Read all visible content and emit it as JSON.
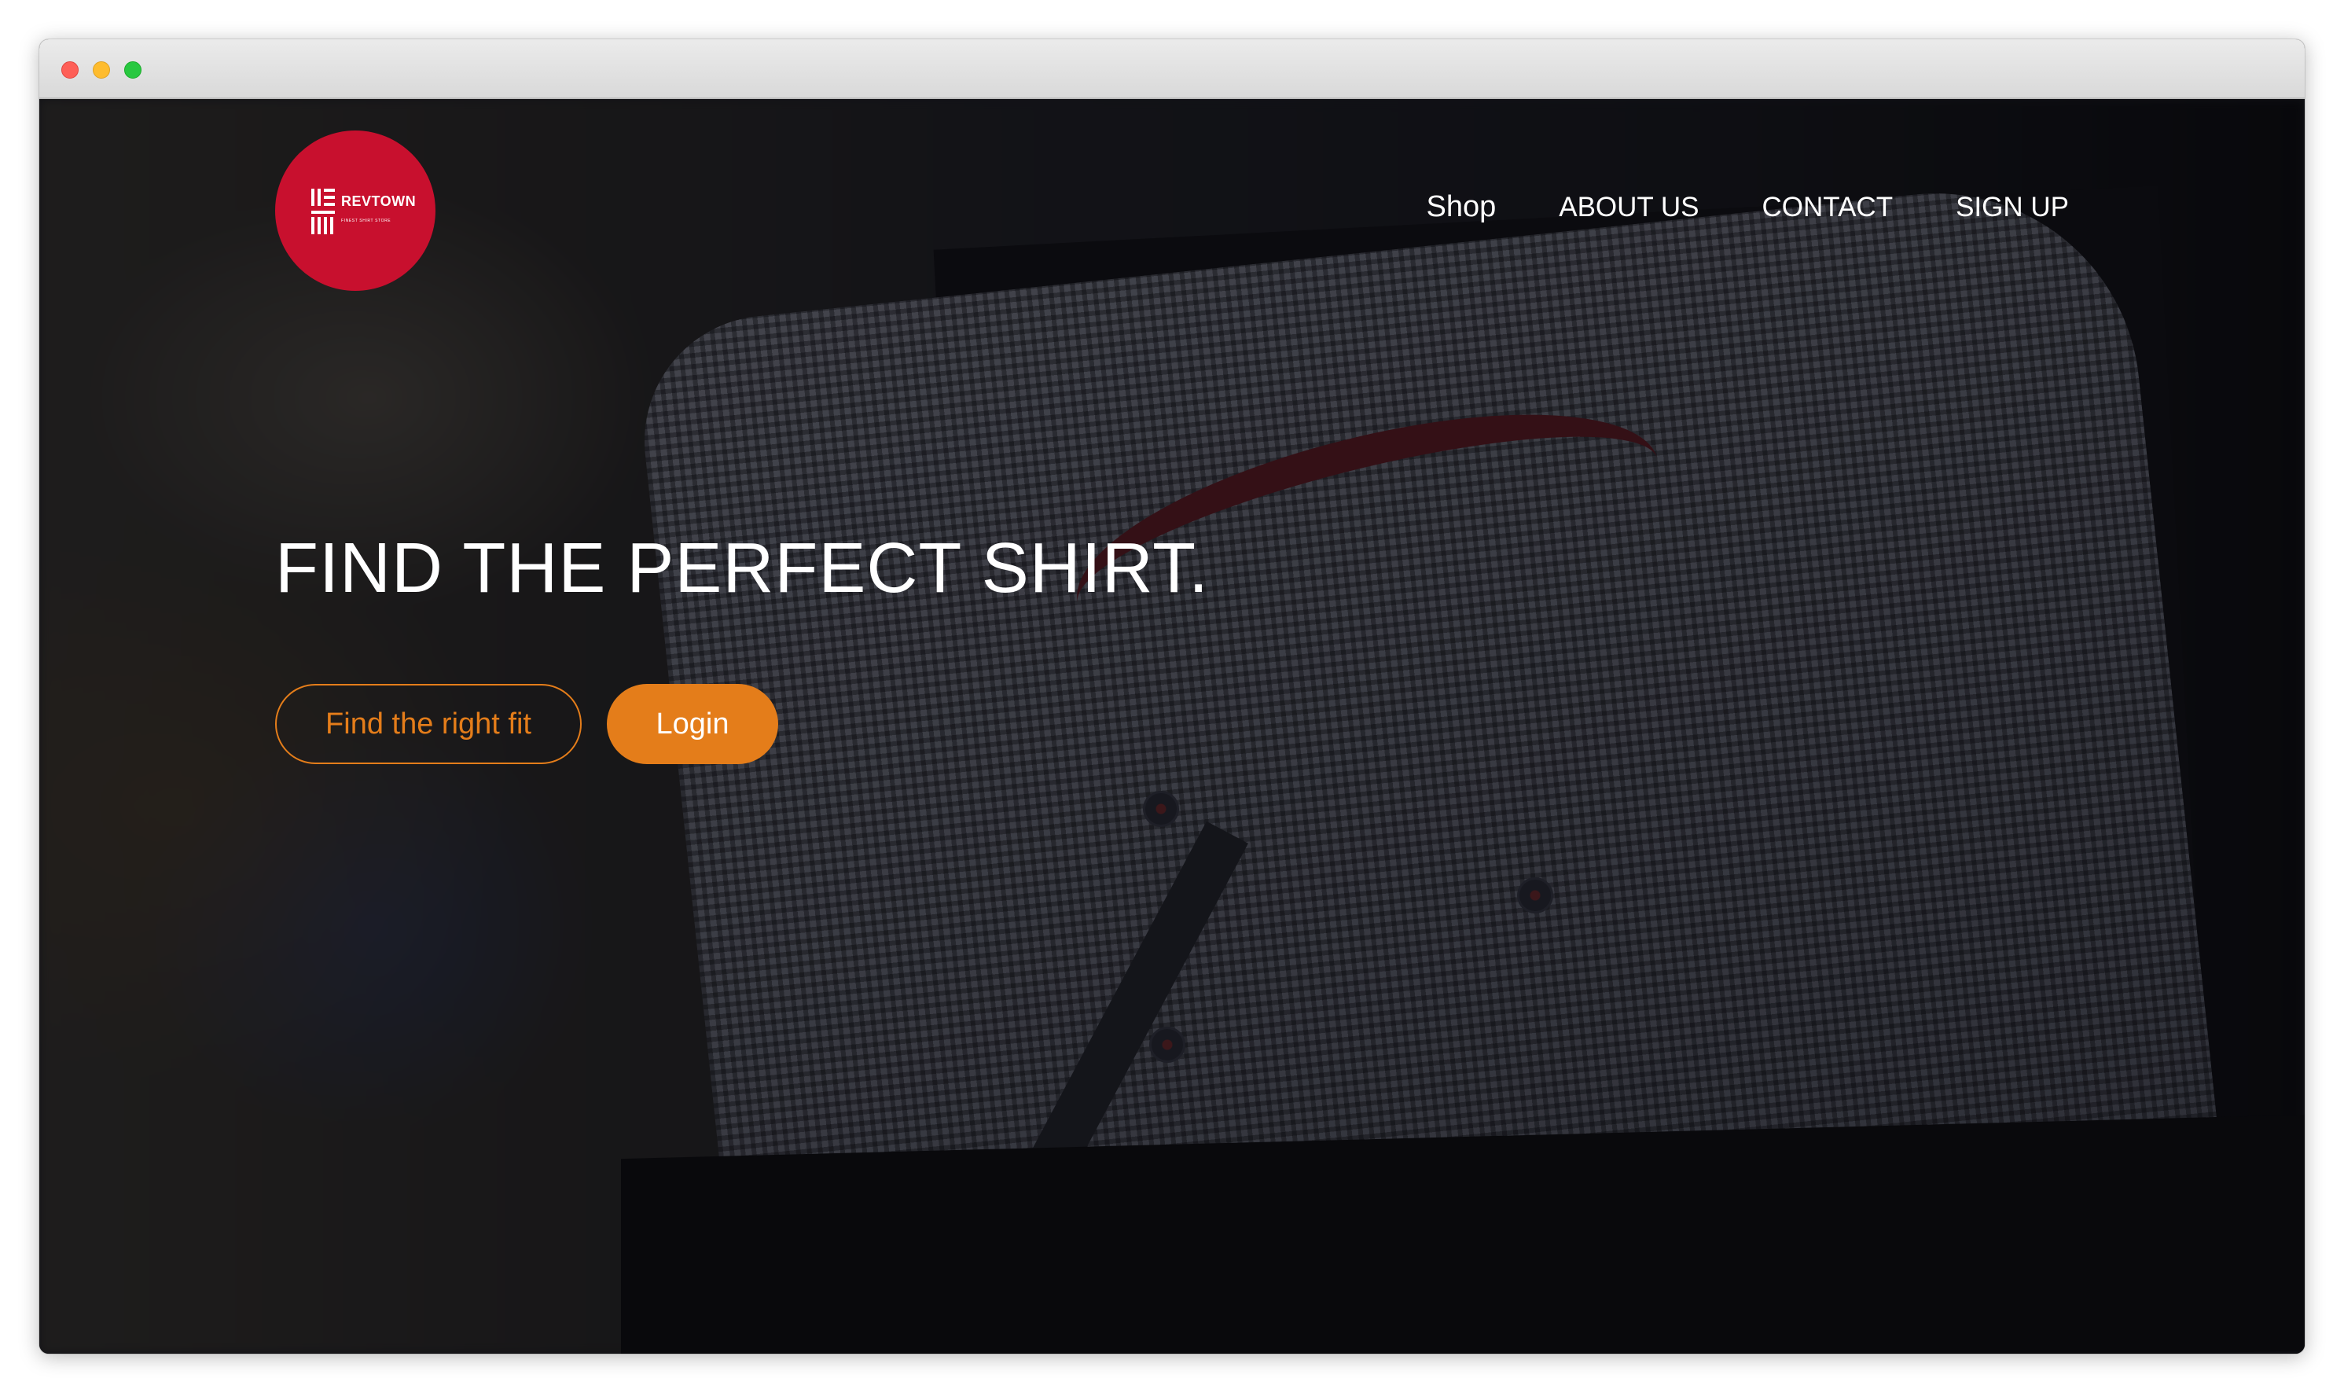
{
  "window": {
    "controls": [
      "close",
      "minimize",
      "zoom"
    ]
  },
  "brand": {
    "name": "REVTOWN",
    "tagline": "FINEST SHIRT STORE",
    "logo_color": "#c8102e"
  },
  "nav": {
    "items": [
      {
        "label": "Shop"
      },
      {
        "label": "ABOUT US"
      },
      {
        "label": "CONTACT"
      },
      {
        "label": "SIGN UP"
      }
    ]
  },
  "hero": {
    "headline": "FIND THE PERFECT SHIRT.",
    "secondary_button": "Find the right fit",
    "primary_button": "Login",
    "accent_color": "#e47d1a"
  }
}
